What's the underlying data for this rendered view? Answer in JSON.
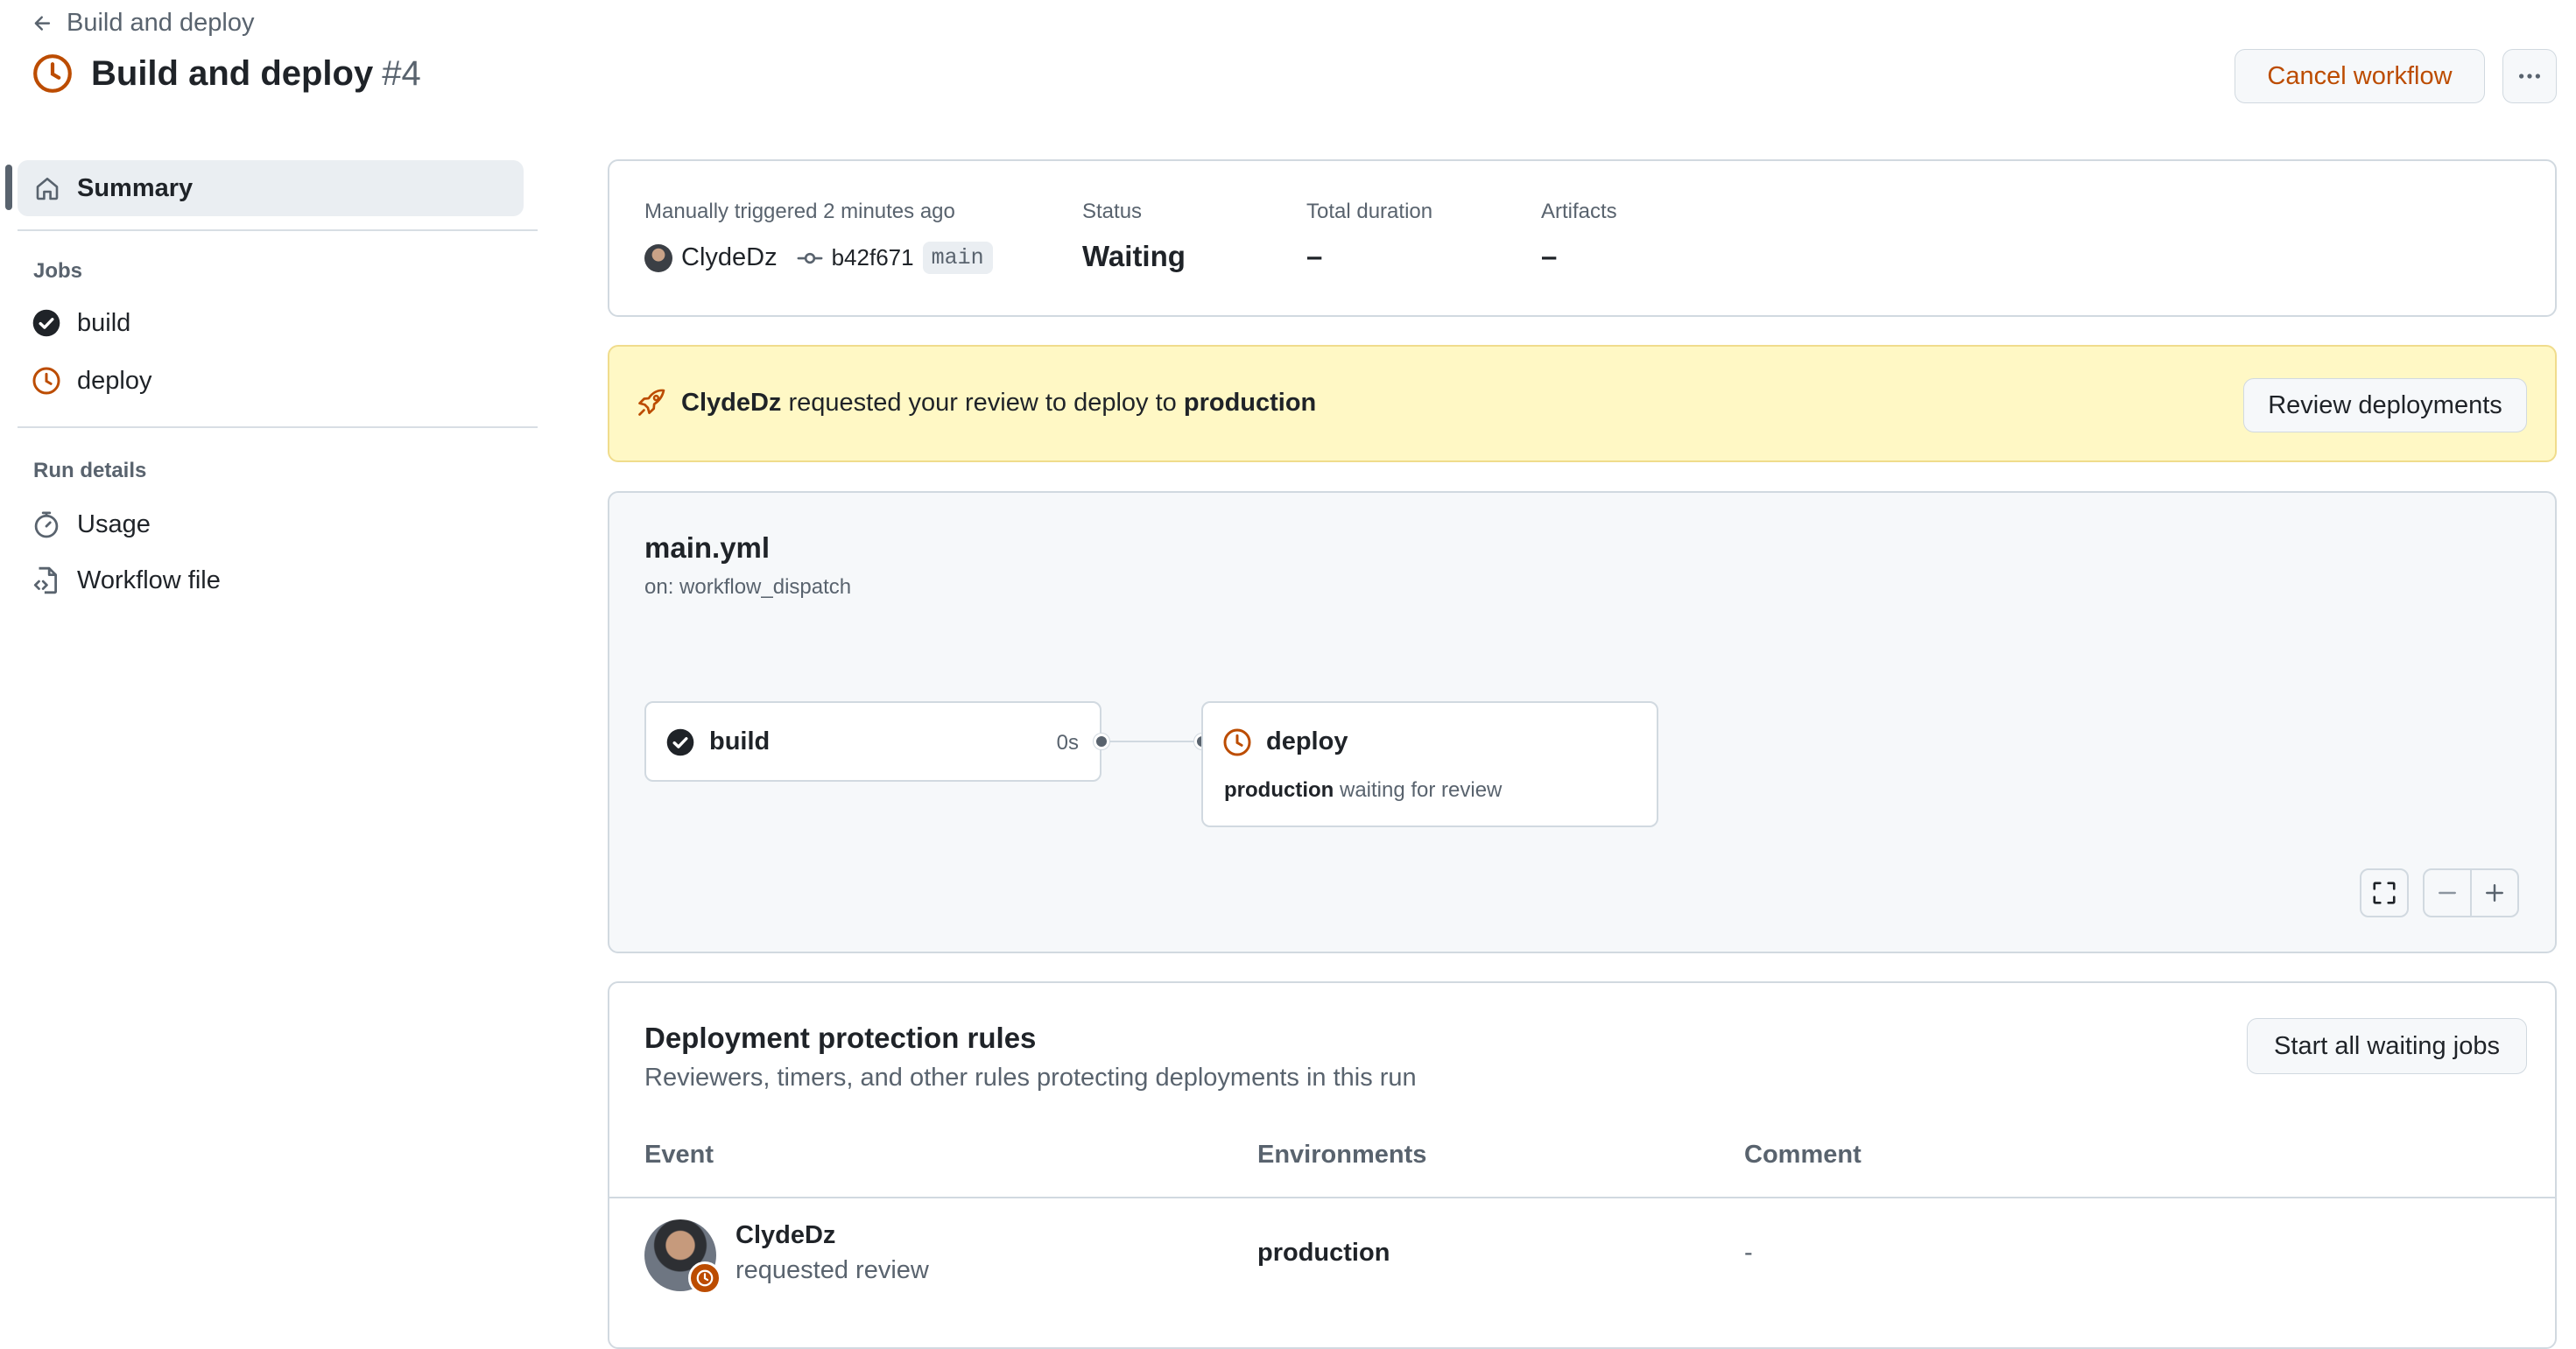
{
  "header": {
    "back_label": "Build and deploy",
    "title": "Build and deploy",
    "run_number": "#4",
    "cancel_label": "Cancel workflow"
  },
  "sidebar": {
    "summary_label": "Summary",
    "jobs_heading": "Jobs",
    "jobs": [
      {
        "label": "build",
        "status": "success"
      },
      {
        "label": "deploy",
        "status": "waiting"
      }
    ],
    "run_details_heading": "Run details",
    "run_details": [
      {
        "label": "Usage",
        "icon": "stopwatch-icon"
      },
      {
        "label": "Workflow file",
        "icon": "file-code-icon"
      }
    ]
  },
  "summary": {
    "trigger_text": "Manually triggered 2 minutes ago",
    "actor": "ClydeDz",
    "commit": "b42f671",
    "branch": "main",
    "status_label": "Status",
    "status_value": "Waiting",
    "duration_label": "Total duration",
    "duration_value": "–",
    "artifacts_label": "Artifacts",
    "artifacts_value": "–"
  },
  "review_banner": {
    "actor": "ClydeDz",
    "text": "requested your review to deploy to",
    "environment": "production",
    "button_label": "Review deployments"
  },
  "graph": {
    "filename": "main.yml",
    "trigger": "on: workflow_dispatch",
    "jobs": [
      {
        "name": "build",
        "duration": "0s",
        "status": "success"
      },
      {
        "name": "deploy",
        "env": "production",
        "note": "waiting for review",
        "status": "waiting"
      }
    ]
  },
  "rules": {
    "title": "Deployment protection rules",
    "subtitle": "Reviewers, timers, and other rules protecting deployments in this run",
    "start_button_label": "Start all waiting jobs",
    "columns": [
      "Event",
      "Environments",
      "Comment"
    ],
    "rows": [
      {
        "user": "ClydeDz",
        "action": "requested review",
        "environment": "production",
        "comment": "-"
      }
    ]
  },
  "colors": {
    "accent_waiting": "#bc4c00",
    "success": "#1f2328",
    "banner_bg": "#fff8c5",
    "text_muted": "#59636e"
  }
}
